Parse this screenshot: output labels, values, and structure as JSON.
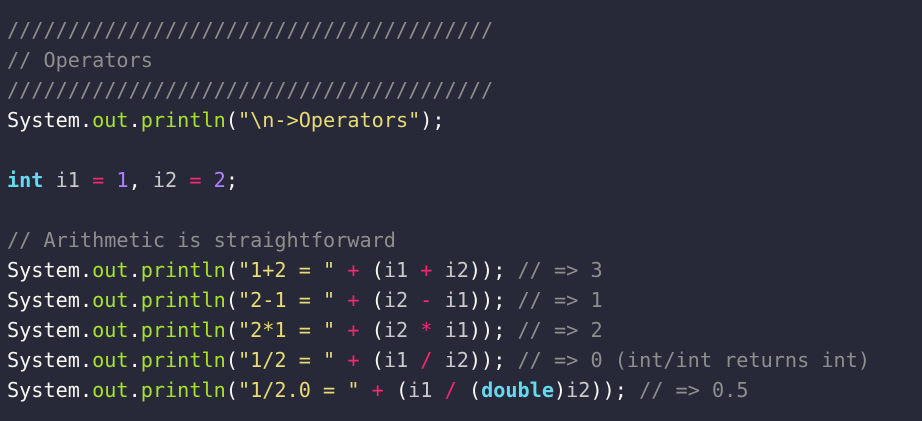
{
  "editor": {
    "language": "java",
    "lines": [
      [
        {
          "t": "comment",
          "v": "////////////////////////////////////////"
        }
      ],
      [
        {
          "t": "comment",
          "v": "// Operators"
        }
      ],
      [
        {
          "t": "comment",
          "v": "////////////////////////////////////////"
        }
      ],
      [
        {
          "t": "plain",
          "v": "System"
        },
        {
          "t": "punct",
          "v": "."
        },
        {
          "t": "member",
          "v": "out"
        },
        {
          "t": "punct",
          "v": "."
        },
        {
          "t": "member",
          "v": "println"
        },
        {
          "t": "punct",
          "v": "("
        },
        {
          "t": "string",
          "v": "\"\\n->Operators\""
        },
        {
          "t": "punct",
          "v": ");"
        }
      ],
      [],
      [
        {
          "t": "keyword",
          "v": "int"
        },
        {
          "t": "plain",
          "v": " "
        },
        {
          "t": "var",
          "v": "i1"
        },
        {
          "t": "plain",
          "v": " "
        },
        {
          "t": "op",
          "v": "="
        },
        {
          "t": "plain",
          "v": " "
        },
        {
          "t": "number",
          "v": "1"
        },
        {
          "t": "punct",
          "v": ","
        },
        {
          "t": "plain",
          "v": " "
        },
        {
          "t": "var",
          "v": "i2"
        },
        {
          "t": "plain",
          "v": " "
        },
        {
          "t": "op",
          "v": "="
        },
        {
          "t": "plain",
          "v": " "
        },
        {
          "t": "number",
          "v": "2"
        },
        {
          "t": "punct",
          "v": ";"
        }
      ],
      [],
      [
        {
          "t": "comment",
          "v": "// Arithmetic is straightforward"
        }
      ],
      [
        {
          "t": "plain",
          "v": "System"
        },
        {
          "t": "punct",
          "v": "."
        },
        {
          "t": "member",
          "v": "out"
        },
        {
          "t": "punct",
          "v": "."
        },
        {
          "t": "member",
          "v": "println"
        },
        {
          "t": "punct",
          "v": "("
        },
        {
          "t": "string",
          "v": "\"1+2 = \""
        },
        {
          "t": "plain",
          "v": " "
        },
        {
          "t": "op",
          "v": "+"
        },
        {
          "t": "plain",
          "v": " "
        },
        {
          "t": "punct",
          "v": "("
        },
        {
          "t": "var",
          "v": "i1"
        },
        {
          "t": "plain",
          "v": " "
        },
        {
          "t": "op",
          "v": "+"
        },
        {
          "t": "plain",
          "v": " "
        },
        {
          "t": "var",
          "v": "i2"
        },
        {
          "t": "punct",
          "v": "));"
        },
        {
          "t": "plain",
          "v": " "
        },
        {
          "t": "comment",
          "v": "// => 3"
        }
      ],
      [
        {
          "t": "plain",
          "v": "System"
        },
        {
          "t": "punct",
          "v": "."
        },
        {
          "t": "member",
          "v": "out"
        },
        {
          "t": "punct",
          "v": "."
        },
        {
          "t": "member",
          "v": "println"
        },
        {
          "t": "punct",
          "v": "("
        },
        {
          "t": "string",
          "v": "\"2-1 = \""
        },
        {
          "t": "plain",
          "v": " "
        },
        {
          "t": "op",
          "v": "+"
        },
        {
          "t": "plain",
          "v": " "
        },
        {
          "t": "punct",
          "v": "("
        },
        {
          "t": "var",
          "v": "i2"
        },
        {
          "t": "plain",
          "v": " "
        },
        {
          "t": "op",
          "v": "-"
        },
        {
          "t": "plain",
          "v": " "
        },
        {
          "t": "var",
          "v": "i1"
        },
        {
          "t": "punct",
          "v": "));"
        },
        {
          "t": "plain",
          "v": " "
        },
        {
          "t": "comment",
          "v": "// => 1"
        }
      ],
      [
        {
          "t": "plain",
          "v": "System"
        },
        {
          "t": "punct",
          "v": "."
        },
        {
          "t": "member",
          "v": "out"
        },
        {
          "t": "punct",
          "v": "."
        },
        {
          "t": "member",
          "v": "println"
        },
        {
          "t": "punct",
          "v": "("
        },
        {
          "t": "string",
          "v": "\"2*1 = \""
        },
        {
          "t": "plain",
          "v": " "
        },
        {
          "t": "op",
          "v": "+"
        },
        {
          "t": "plain",
          "v": " "
        },
        {
          "t": "punct",
          "v": "("
        },
        {
          "t": "var",
          "v": "i2"
        },
        {
          "t": "plain",
          "v": " "
        },
        {
          "t": "op",
          "v": "*"
        },
        {
          "t": "plain",
          "v": " "
        },
        {
          "t": "var",
          "v": "i1"
        },
        {
          "t": "punct",
          "v": "));"
        },
        {
          "t": "plain",
          "v": " "
        },
        {
          "t": "comment",
          "v": "// => 2"
        }
      ],
      [
        {
          "t": "plain",
          "v": "System"
        },
        {
          "t": "punct",
          "v": "."
        },
        {
          "t": "member",
          "v": "out"
        },
        {
          "t": "punct",
          "v": "."
        },
        {
          "t": "member",
          "v": "println"
        },
        {
          "t": "punct",
          "v": "("
        },
        {
          "t": "string",
          "v": "\"1/2 = \""
        },
        {
          "t": "plain",
          "v": " "
        },
        {
          "t": "op",
          "v": "+"
        },
        {
          "t": "plain",
          "v": " "
        },
        {
          "t": "punct",
          "v": "("
        },
        {
          "t": "var",
          "v": "i1"
        },
        {
          "t": "plain",
          "v": " "
        },
        {
          "t": "op",
          "v": "/"
        },
        {
          "t": "plain",
          "v": " "
        },
        {
          "t": "var",
          "v": "i2"
        },
        {
          "t": "punct",
          "v": "));"
        },
        {
          "t": "plain",
          "v": " "
        },
        {
          "t": "comment",
          "v": "// => 0 (int/int returns int)"
        }
      ],
      [
        {
          "t": "plain",
          "v": "System"
        },
        {
          "t": "punct",
          "v": "."
        },
        {
          "t": "member",
          "v": "out"
        },
        {
          "t": "punct",
          "v": "."
        },
        {
          "t": "member",
          "v": "println"
        },
        {
          "t": "punct",
          "v": "("
        },
        {
          "t": "string",
          "v": "\"1/2.0 = \""
        },
        {
          "t": "plain",
          "v": " "
        },
        {
          "t": "op",
          "v": "+"
        },
        {
          "t": "plain",
          "v": " "
        },
        {
          "t": "punct",
          "v": "("
        },
        {
          "t": "var",
          "v": "i1"
        },
        {
          "t": "plain",
          "v": " "
        },
        {
          "t": "op",
          "v": "/"
        },
        {
          "t": "plain",
          "v": " "
        },
        {
          "t": "punct",
          "v": "("
        },
        {
          "t": "keyword",
          "v": "double"
        },
        {
          "t": "punct",
          "v": ")"
        },
        {
          "t": "var",
          "v": "i2"
        },
        {
          "t": "punct",
          "v": "));"
        },
        {
          "t": "plain",
          "v": " "
        },
        {
          "t": "comment",
          "v": "// => 0.5"
        }
      ]
    ]
  },
  "colors": {
    "background": "#272838",
    "comment": "#8e8e8e",
    "plain": "#f8f8f2",
    "member": "#a6e22e",
    "string": "#e6db74",
    "operator": "#f92672",
    "number": "#ae81ff",
    "keyword": "#66d9ef"
  }
}
